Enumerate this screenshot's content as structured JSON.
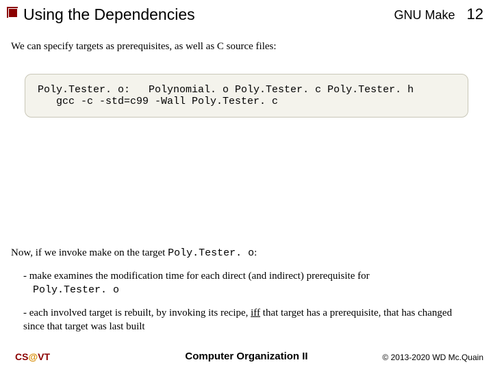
{
  "header": {
    "title": "Using the Dependencies",
    "course": "GNU Make",
    "page": "12"
  },
  "intro": "We can specify targets as prerequisites, as well as C source files:",
  "code": {
    "line1": "Poly.Tester. o:   Polynomial. o Poly.Tester. c Poly.Tester. h",
    "line2": "   gcc -c -std=c99 -Wall Poly.Tester. c"
  },
  "para2_prefix": "Now, if we invoke make on the target ",
  "para2_mono": "Poly.Tester. o",
  "para2_suffix": ":",
  "bullet1_prefix": "-  make examines the modification time for each direct (and indirect) prerequisite for ",
  "bullet1_mono": "Poly.Tester. o",
  "bullet2_prefix": "-  each involved target is rebuilt, by invoking its recipe, ",
  "bullet2_iff": "iff",
  "bullet2_suffix": " that target has a prerequisite, that has changed since that target was last built",
  "footer": {
    "left_cs": "CS",
    "left_at": "@",
    "left_vt": "VT",
    "center": "Computer Organization II",
    "right": "© 2013-2020 WD Mc.Quain"
  }
}
